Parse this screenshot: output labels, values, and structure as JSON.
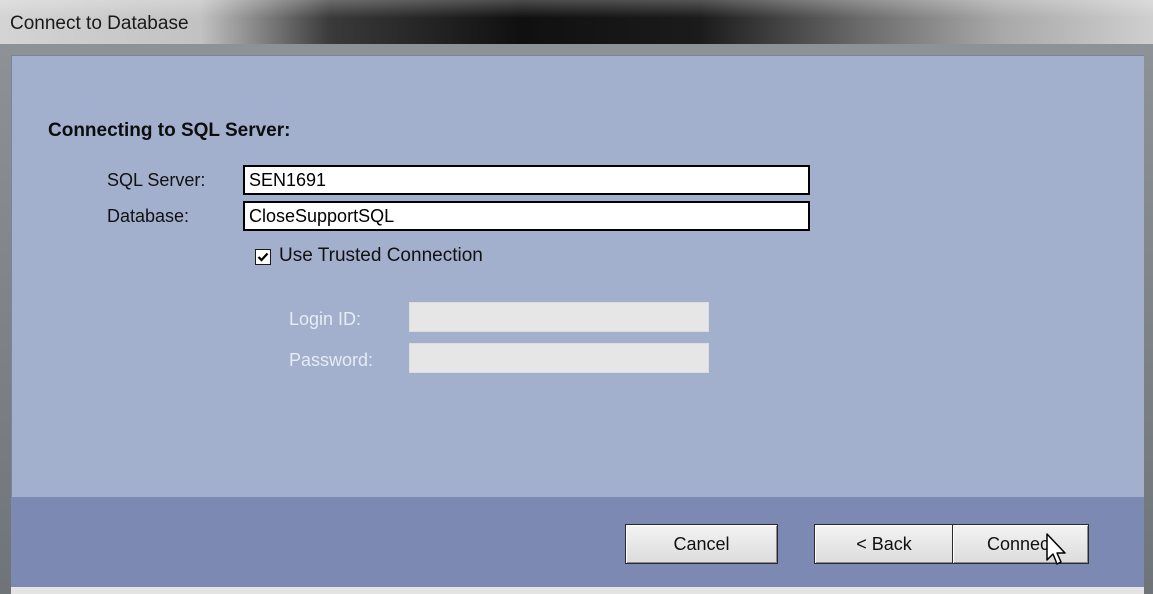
{
  "window": {
    "title": "Connect to Database"
  },
  "form": {
    "heading": "Connecting to SQL Server:",
    "server_label": "SQL Server:",
    "server_value": "SEN1691",
    "database_label": "Database:",
    "database_value": "CloseSupportSQL",
    "trusted_label": "Use Trusted Connection",
    "trusted_checked": true,
    "login_label": "Login ID:",
    "login_value": "",
    "password_label": "Password:",
    "password_value": ""
  },
  "buttons": {
    "cancel": "Cancel",
    "back": "< Back",
    "connect": "Connect"
  },
  "colors": {
    "content_bg": "#a2b0cd",
    "footer_bg": "#7b89b3"
  },
  "icons": {
    "checkbox": "checkmark-icon",
    "cursor": "arrow-cursor-icon"
  }
}
